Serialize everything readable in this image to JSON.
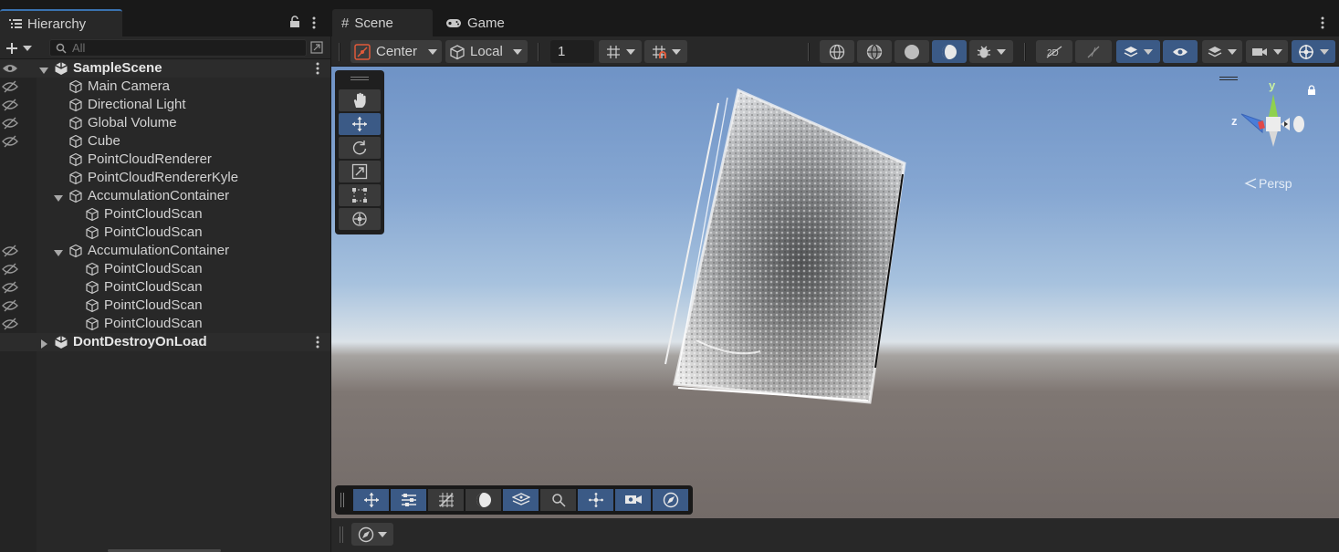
{
  "hierarchy": {
    "tab_label": "Hierarchy",
    "search_placeholder": "All",
    "rows": [
      {
        "label": "SampleScene",
        "kind": "scene",
        "depth": 0,
        "expanded": true
      },
      {
        "label": "Main Camera",
        "kind": "object",
        "depth": 1,
        "hidden": true
      },
      {
        "label": "Directional Light",
        "kind": "object",
        "depth": 1,
        "hidden": true
      },
      {
        "label": "Global Volume",
        "kind": "object",
        "depth": 1,
        "hidden": true
      },
      {
        "label": "Cube",
        "kind": "object",
        "depth": 1,
        "hidden": true
      },
      {
        "label": "PointCloudRenderer",
        "kind": "object",
        "depth": 1
      },
      {
        "label": "PointCloudRendererKyle",
        "kind": "object",
        "depth": 1
      },
      {
        "label": "AccumulationContainer",
        "kind": "object",
        "depth": 1,
        "expanded": true
      },
      {
        "label": "PointCloudScan",
        "kind": "object",
        "depth": 2
      },
      {
        "label": "PointCloudScan",
        "kind": "object",
        "depth": 2
      },
      {
        "label": "AccumulationContainer",
        "kind": "object",
        "depth": 1,
        "expanded": true,
        "hidden": true
      },
      {
        "label": "PointCloudScan",
        "kind": "object",
        "depth": 2,
        "hidden": true
      },
      {
        "label": "PointCloudScan",
        "kind": "object",
        "depth": 2,
        "hidden": true
      },
      {
        "label": "PointCloudScan",
        "kind": "object",
        "depth": 2,
        "hidden": true
      },
      {
        "label": "PointCloudScan",
        "kind": "object",
        "depth": 2,
        "hidden": true
      },
      {
        "label": "DontDestroyOnLoad",
        "kind": "scene",
        "depth": 0,
        "expanded": false
      }
    ]
  },
  "scene_view": {
    "tabs": {
      "scene": "Scene",
      "game": "Game"
    },
    "toolbar": {
      "pivot_mode": "Center",
      "pivot_rotation": "Local",
      "grid_snap_value": "1"
    },
    "gizmo": {
      "axis_y": "y",
      "axis_z": "z",
      "projection": "Persp"
    }
  },
  "colors": {
    "accent": "#3b5a86",
    "panel_bg": "#282828",
    "tab_bg": "#191919",
    "gizmo_y": "#8fd14f",
    "gizmo_z": "#4a7dd8",
    "gizmo_x": "#e04848"
  }
}
